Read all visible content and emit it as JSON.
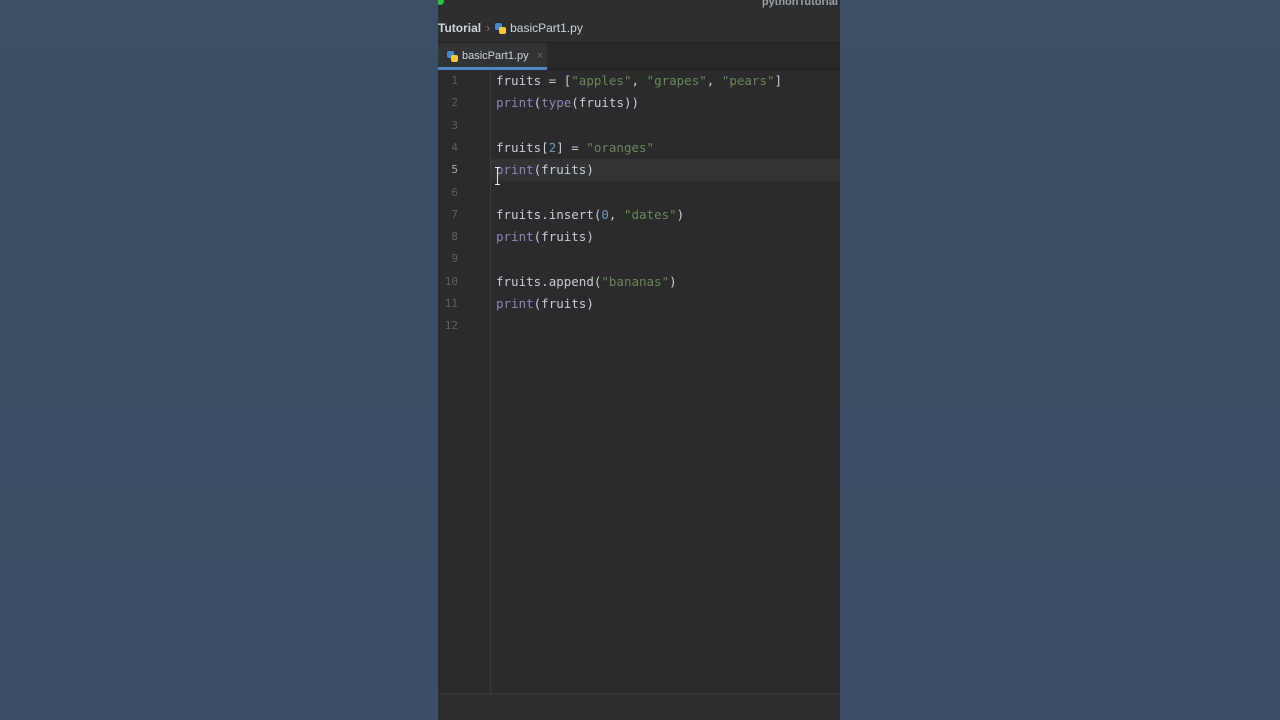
{
  "window": {
    "project_title": "pythonTutorial"
  },
  "breadcrumb": {
    "project": "Tutorial",
    "file": "basicPart1.py"
  },
  "tabs": [
    {
      "label": "basicPart1.py",
      "close": "×"
    }
  ],
  "editor": {
    "current_line": 5,
    "lines": [
      {
        "no": "1",
        "code": "fruits = [\"apples\", \"grapes\", \"pears\"]"
      },
      {
        "no": "2",
        "code": "print(type(fruits))"
      },
      {
        "no": "3",
        "code": ""
      },
      {
        "no": "4",
        "code": "fruits[2] = \"oranges\""
      },
      {
        "no": "5",
        "code": "print(fruits)"
      },
      {
        "no": "6",
        "code": ""
      },
      {
        "no": "7",
        "code": "fruits.insert(0, \"dates\")"
      },
      {
        "no": "8",
        "code": "print(fruits)"
      },
      {
        "no": "9",
        "code": ""
      },
      {
        "no": "10",
        "code": "fruits.append(\"bananas\")"
      },
      {
        "no": "11",
        "code": "print(fruits)"
      },
      {
        "no": "12",
        "code": ""
      }
    ]
  },
  "colors": {
    "editor_bg": "#2b2b2d",
    "string": "#6a8759",
    "number": "#6897bb",
    "builtin": "#8b87b3",
    "identifier": "#c8ccd0",
    "tab_accent": "#4a88c7"
  }
}
